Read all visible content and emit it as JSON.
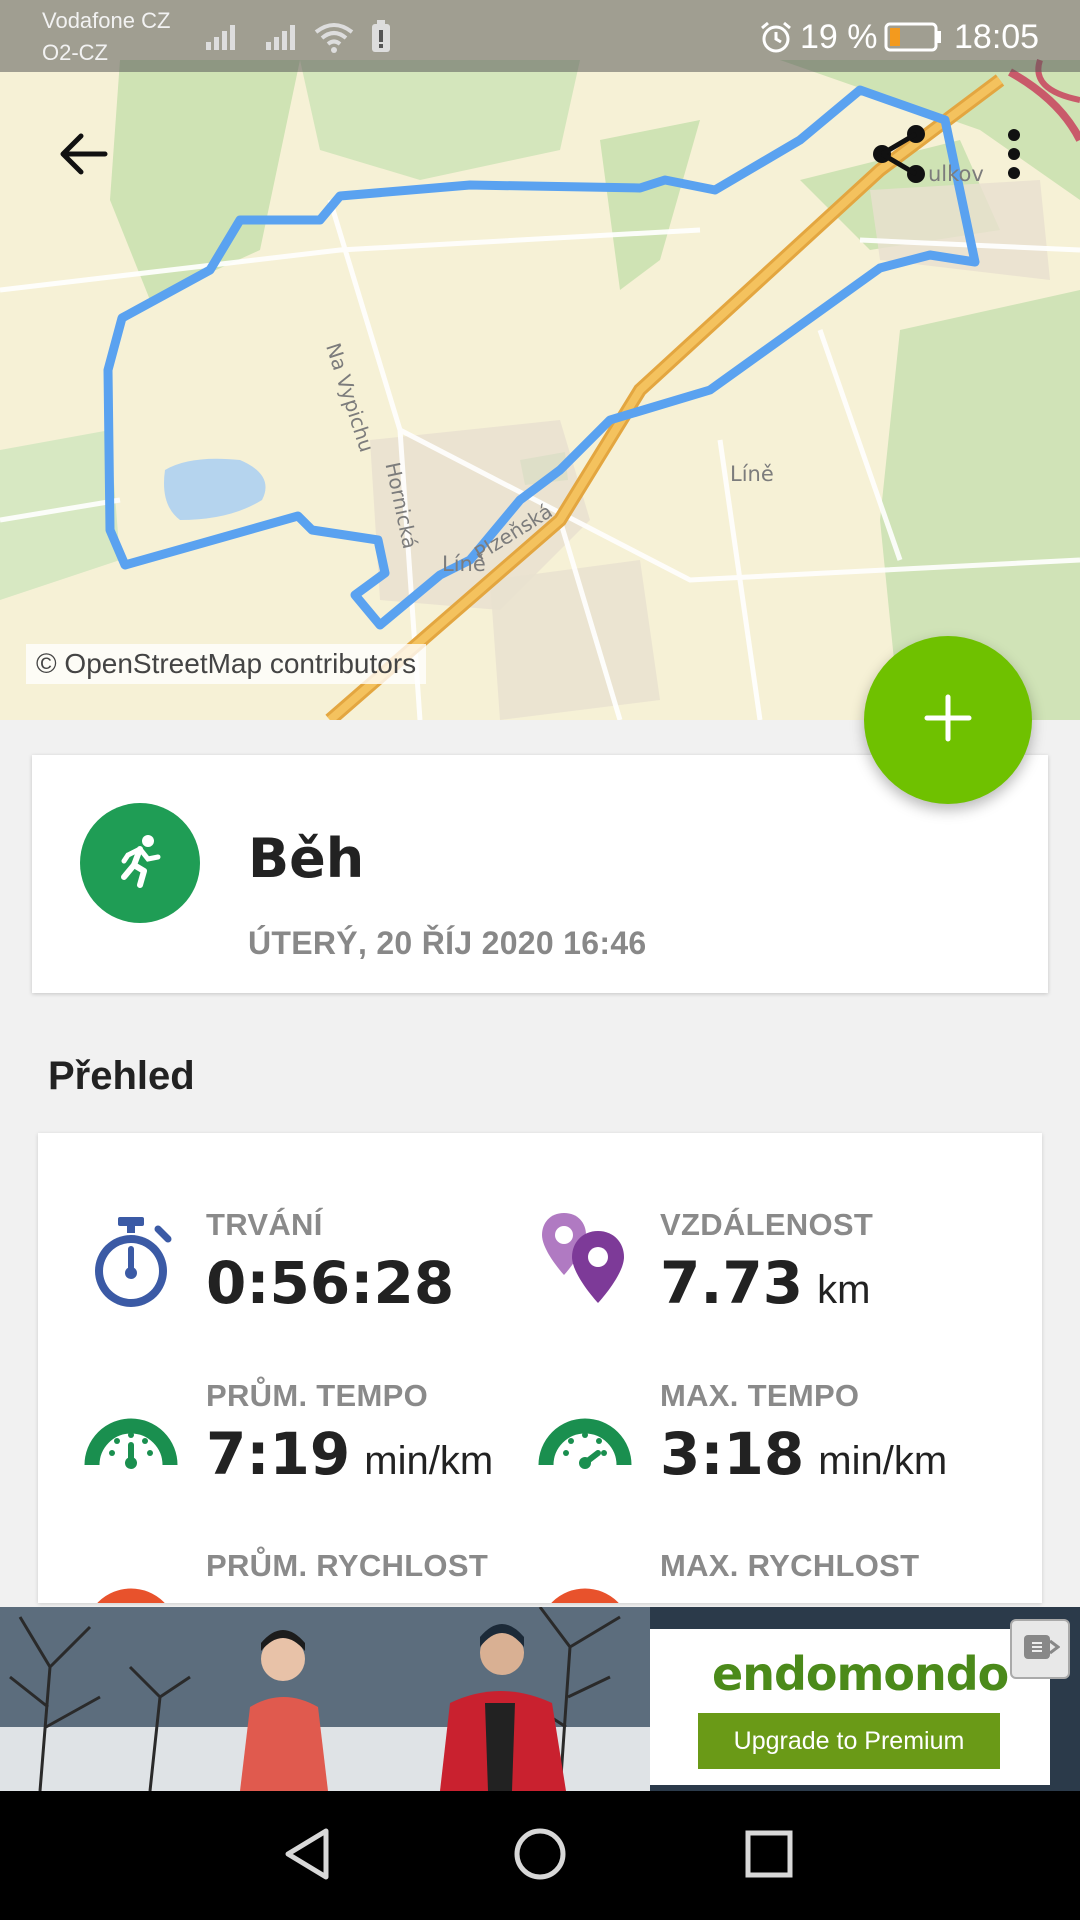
{
  "status_bar": {
    "carrier_line1": "Vodafone CZ",
    "carrier_line2": "O2-CZ",
    "battery_percent": "19 %",
    "time": "18:05"
  },
  "map": {
    "labels": {
      "street1": "Na Vypichu",
      "street2": "Hornická",
      "street3": "Plzeňská",
      "village1": "Líně",
      "village2": "Líně",
      "village3": "ulkov"
    },
    "credit": "© OpenStreetMap contributors",
    "route_color": "#5aa2f0"
  },
  "appbar": {
    "back_icon": "arrow-left-icon",
    "share_icon": "share-icon",
    "more_icon": "more-vert-icon"
  },
  "fab": {
    "icon": "plus-icon",
    "color": "#6fc100"
  },
  "workout": {
    "sport": "Běh",
    "sport_icon": "running-icon",
    "date": "ÚTERÝ, 20 ŘÍJ 2020 16:46",
    "sport_color": "#1f9d55"
  },
  "overview": {
    "title": "Přehled",
    "stats": [
      {
        "label": "TRVÁNÍ",
        "value": "0:56:28",
        "unit": "",
        "icon": "stopwatch-icon"
      },
      {
        "label": "VZDÁLENOST",
        "value": "7.73",
        "unit": "km",
        "icon": "location-pins-icon"
      },
      {
        "label": "PRŮM. TEMPO",
        "value": "7:19",
        "unit": "min/km",
        "icon": "speedometer-icon"
      },
      {
        "label": "MAX. TEMPO",
        "value": "3:18",
        "unit": "min/km",
        "icon": "speedometer-icon"
      },
      {
        "label": "PRŮM. RYCHLOST",
        "value": "",
        "unit": "",
        "icon": "speedometer-icon"
      },
      {
        "label": "MAX. RYCHLOST",
        "value": "",
        "unit": "",
        "icon": "speedometer-icon"
      }
    ]
  },
  "ad": {
    "brand": "endomondo",
    "cta": "Upgrade to Premium",
    "close_icon": "close-ad-icon"
  },
  "navbar": {
    "back_icon": "nav-back-icon",
    "home_icon": "nav-home-icon",
    "recents_icon": "nav-recents-icon"
  }
}
